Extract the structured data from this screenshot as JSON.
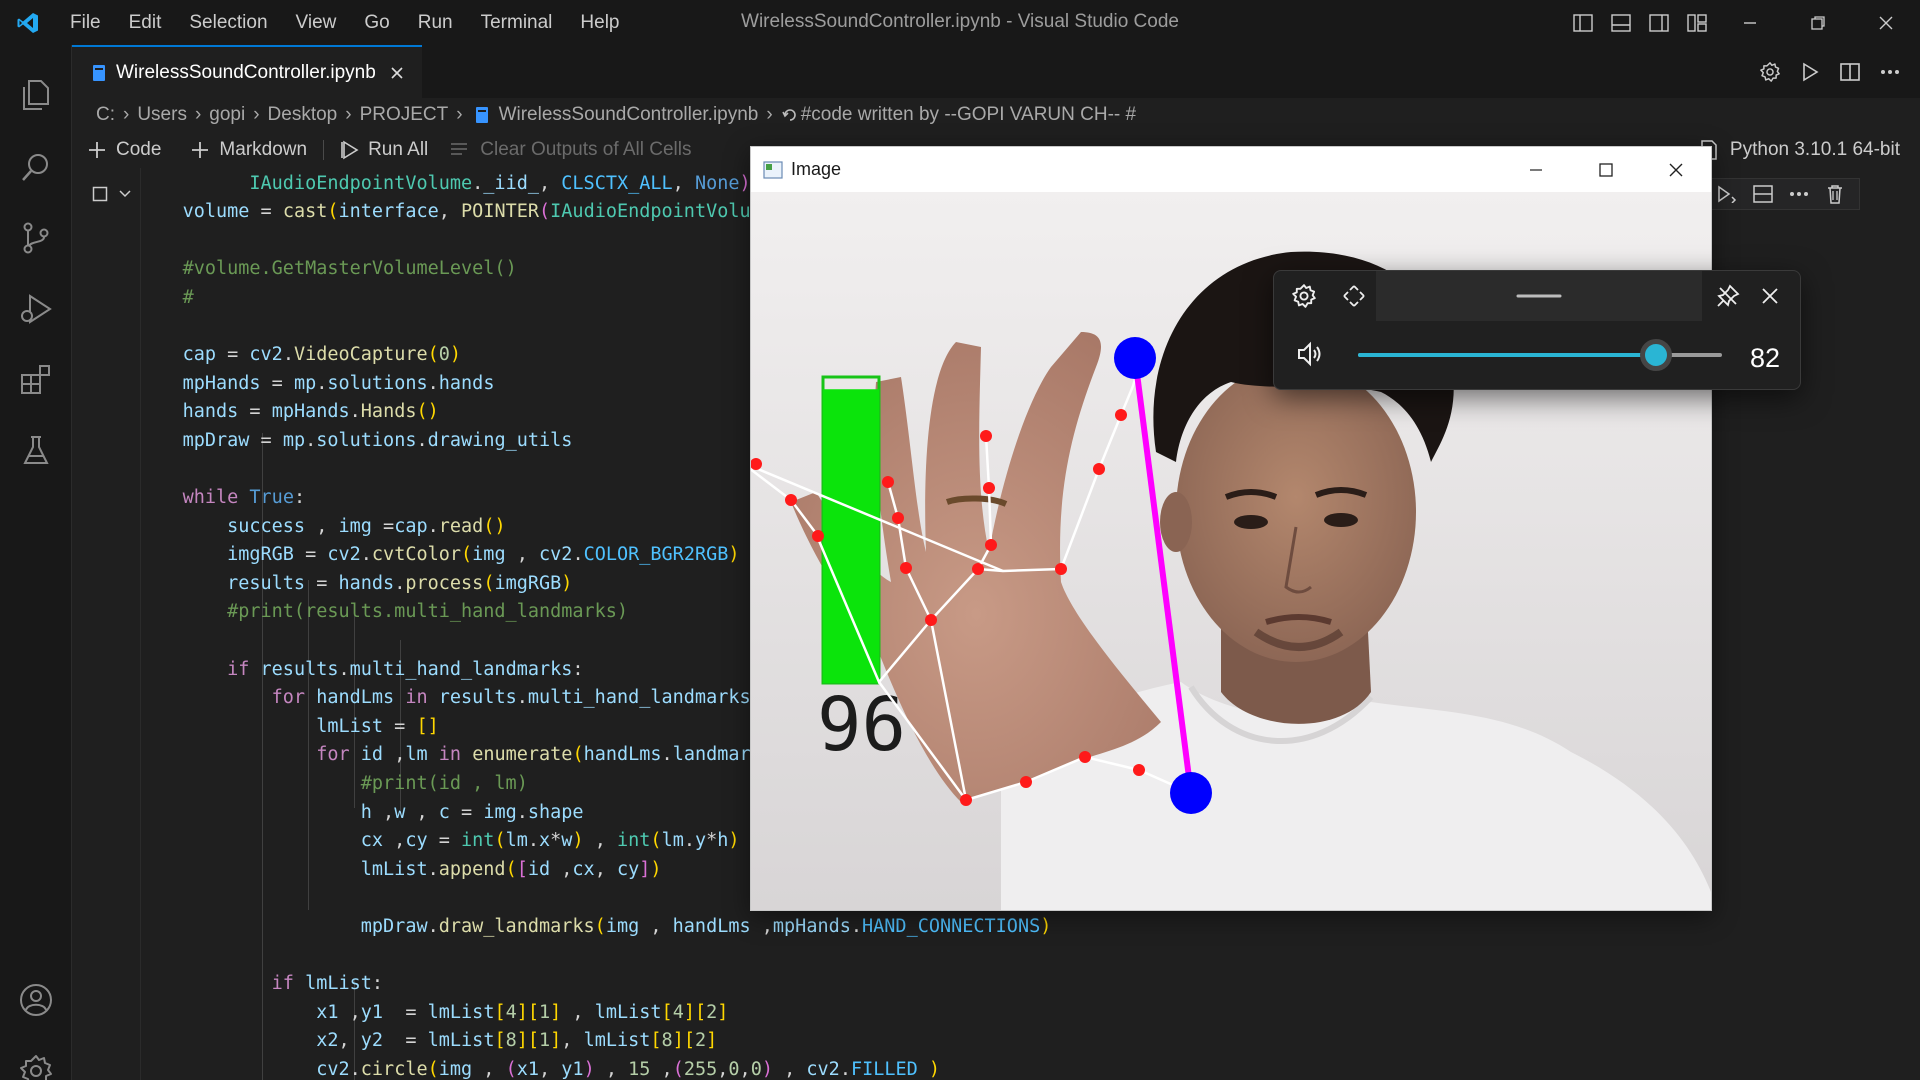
{
  "window_title": "WirelessSoundController.ipynb - Visual Studio Code",
  "menu": [
    "File",
    "Edit",
    "Selection",
    "View",
    "Go",
    "Run",
    "Terminal",
    "Help"
  ],
  "tab": {
    "name": "WirelessSoundController.ipynb"
  },
  "breadcrumb": [
    "C:",
    "Users",
    "gopi",
    "Desktop",
    "PROJECT",
    "WirelessSoundController.ipynb",
    "#code written by --GOPI VARUN CH-- #"
  ],
  "toolbar": {
    "code": "Code",
    "markdown": "Markdown",
    "run_all": "Run All",
    "clear_outputs": "Clear Outputs of All Cells"
  },
  "kernel": "Python 3.10.1 64-bit",
  "image_window": {
    "title": "Image",
    "volume_overlay_number": "96",
    "volume_bar_level": 0.96
  },
  "volume_flyout": {
    "value": "82",
    "level": 0.82
  },
  "colors": {
    "accent": "#0078d4",
    "volume_bar": "#0be40b",
    "landmark_point": "#ff0000",
    "fingertip_circle": "#0000ff",
    "distance_line": "#ff00ff",
    "slider": "#2ab5d4"
  },
  "icons": [
    "vscode-logo-icon",
    "explorer-icon",
    "search-icon",
    "source-control-icon",
    "run-debug-icon",
    "extensions-icon",
    "testing-icon",
    "account-icon",
    "settings-gear-icon"
  ]
}
